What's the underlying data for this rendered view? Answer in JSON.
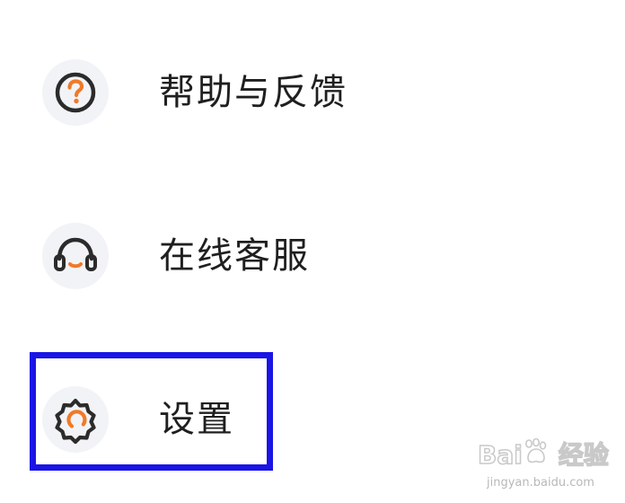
{
  "menu": {
    "items": [
      {
        "label": "帮助与反馈",
        "icon": "help-question-icon"
      },
      {
        "label": "在线客服",
        "icon": "customer-service-headset-icon"
      },
      {
        "label": "设置",
        "icon": "settings-gear-icon"
      }
    ]
  },
  "highlight": {
    "target": "设置",
    "color": "#1a14e6"
  },
  "colors": {
    "accent": "#f07a28",
    "icon_stroke": "#2b2b2b",
    "icon_bg": "#f2f3f7",
    "text": "#1f1f1f"
  },
  "watermark": {
    "brand_prefix": "Bai",
    "brand_suffix": "经验",
    "url": "jingyan.baidu.com"
  }
}
